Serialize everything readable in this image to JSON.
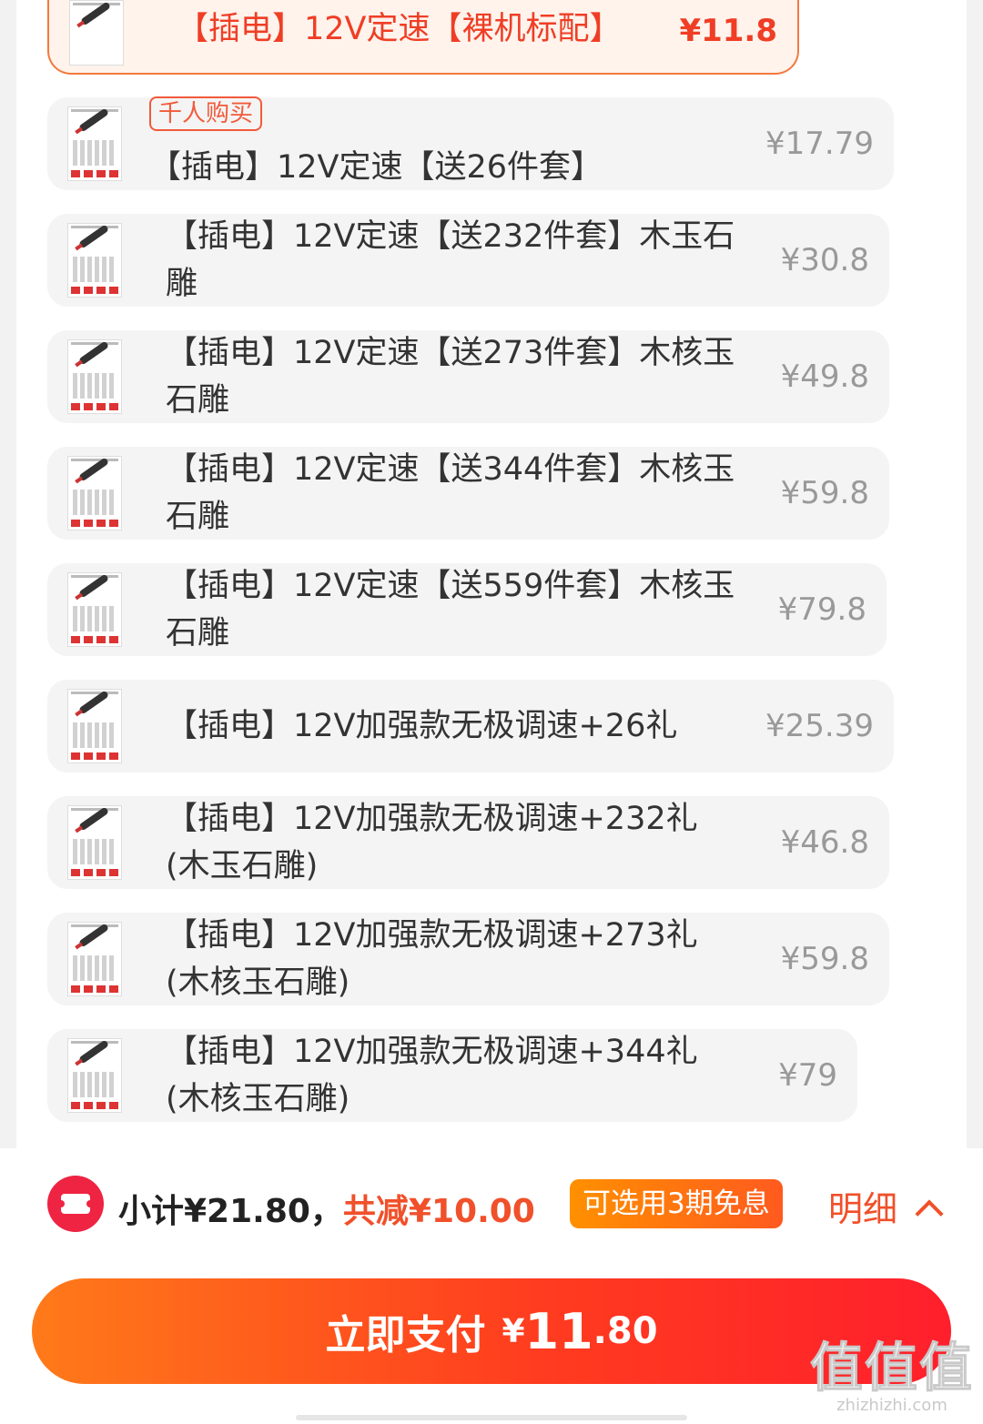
{
  "options": [
    {
      "name": "【插电】12V定速【裸机标配】",
      "price": "¥11.8",
      "selected": true,
      "tag": ""
    },
    {
      "name": "【插电】12V定速【送26件套】",
      "price": "¥17.79",
      "selected": false,
      "tag": "千人购买"
    },
    {
      "name": "【插电】12V定速【送232件套】木玉石雕",
      "price": "¥30.8",
      "selected": false,
      "tag": ""
    },
    {
      "name": "【插电】12V定速【送273件套】木核玉石雕",
      "price": "¥49.8",
      "selected": false,
      "tag": ""
    },
    {
      "name": "【插电】12V定速【送344件套】木核玉石雕",
      "price": "¥59.8",
      "selected": false,
      "tag": ""
    },
    {
      "name": "【插电】12V定速【送559件套】木核玉石雕",
      "price": "¥79.8",
      "selected": false,
      "tag": ""
    },
    {
      "name": "【插电】12V加强款无极调速+26礼",
      "price": "¥25.39",
      "selected": false,
      "tag": ""
    },
    {
      "name": "【插电】12V加强款无极调速+232礼(木玉石雕)",
      "price": "¥46.8",
      "selected": false,
      "tag": ""
    },
    {
      "name": "【插电】12V加强款无极调速+273礼(木核玉石雕)",
      "price": "¥59.8",
      "selected": false,
      "tag": ""
    },
    {
      "name": "【插电】12V加强款无极调速+344礼(木核玉石雕)",
      "price": "¥79",
      "selected": false,
      "tag": ""
    }
  ],
  "summary": {
    "subtotal": "小计¥21.80，",
    "discount": "共减¥10.00",
    "installment": "可选用3期免息",
    "detail": "明细"
  },
  "pay": {
    "label": "立即支付",
    "currency": "¥",
    "amount_int": "11",
    "amount_dec": ".80"
  },
  "watermark": {
    "logo": "值值值",
    "url": "zhizhizhi.com"
  },
  "colors": {
    "accent": "#ef3e25",
    "pay_gradient_start": "#ff7a1a",
    "pay_gradient_end": "#ff1f2c",
    "installment_badge": "#ff7a10"
  },
  "icons": [
    "coupon-icon",
    "chevron-up-icon",
    "product-thumbnail"
  ]
}
